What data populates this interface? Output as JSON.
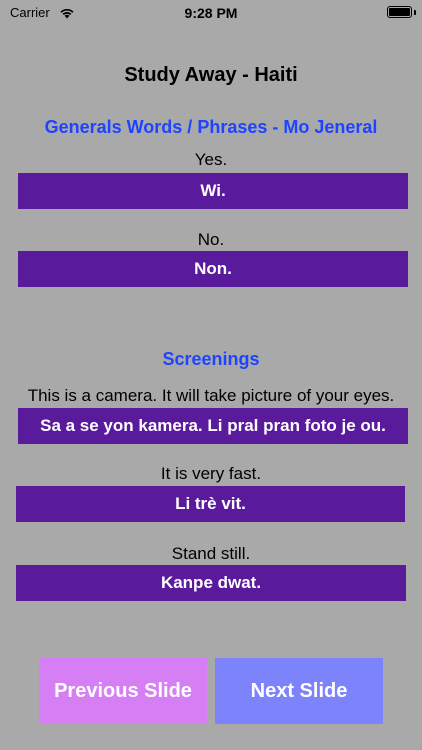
{
  "status": {
    "carrier": "Carrier",
    "time": "9:28 PM",
    "icons": [
      "wifi-icon",
      "battery-icon"
    ]
  },
  "title": "Study Away - Haiti",
  "sections": [
    {
      "heading": "Generals Words / Phrases - Mo Jeneral",
      "items": [
        {
          "english": "Yes.",
          "creole": "Wi."
        },
        {
          "english": "No.",
          "creole": "Non."
        }
      ]
    },
    {
      "heading": "Screenings",
      "items": [
        {
          "english": "This is a camera. It will take picture of your eyes.",
          "creole": "Sa a se yon kamera. Li pral pran foto je ou."
        },
        {
          "english": "It is very fast.",
          "creole": "Li trè vit."
        },
        {
          "english": "Stand still.",
          "creole": "Kanpe dwat."
        }
      ]
    }
  ],
  "buttons": {
    "previous": "Previous Slide",
    "next": "Next Slide"
  },
  "colors": {
    "background": "#a9a9a9",
    "heading": "#1f44ff",
    "answer_bar": "#5a1a9c",
    "previous_button": "#d67ff5",
    "next_button": "#7d84fb"
  }
}
